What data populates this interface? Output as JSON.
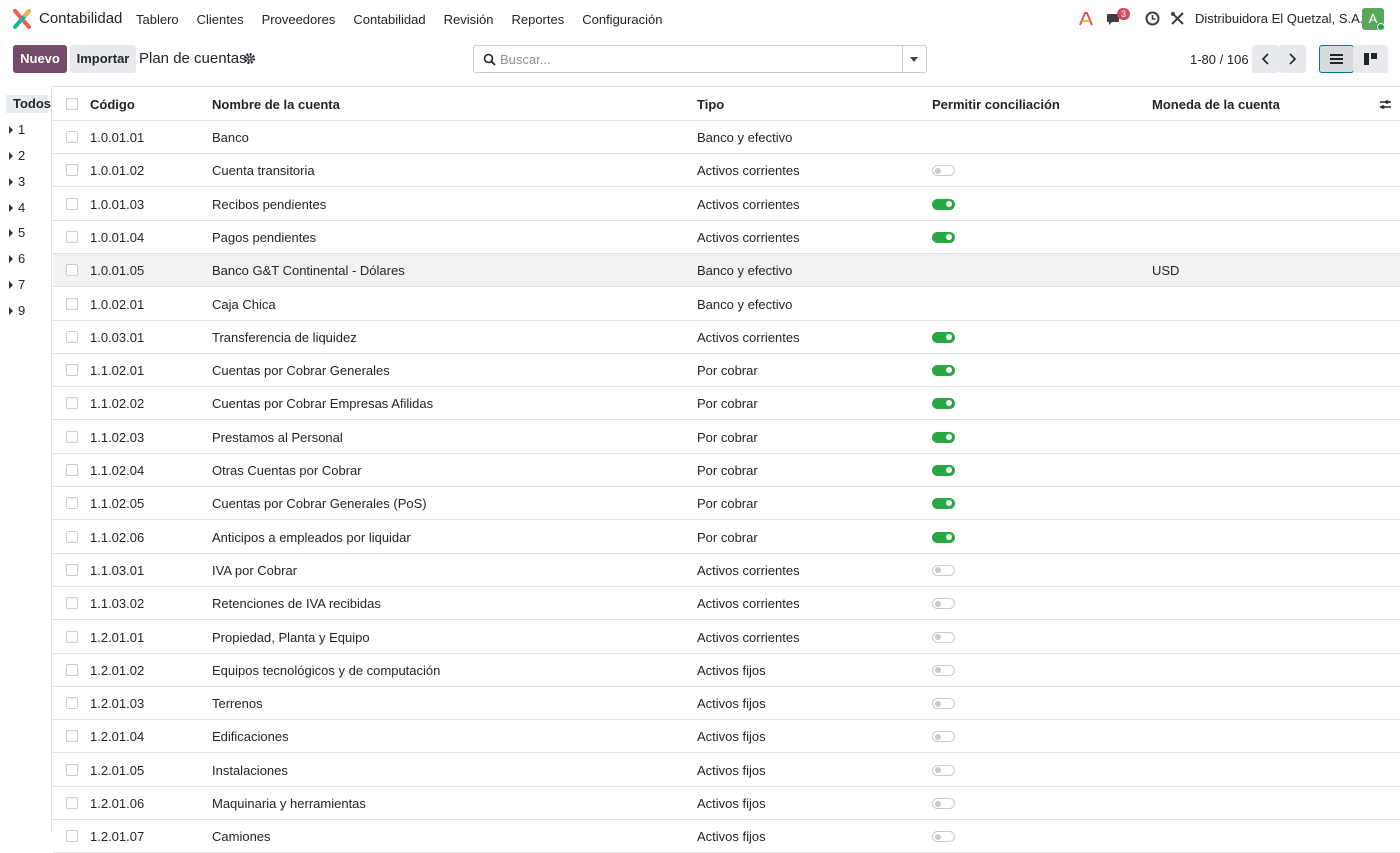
{
  "app": {
    "name": "Contabilidad",
    "menu": [
      "Tablero",
      "Clientes",
      "Proveedores",
      "Contabilidad",
      "Revisión",
      "Reportes",
      "Configuración"
    ],
    "notification_count": "3",
    "company": "Distribuidora El Quetzal, S.A.",
    "avatar_letter": "A",
    "brand_color": "#714b67",
    "toggle_on_color": "#28a745"
  },
  "control": {
    "new_label": "Nuevo",
    "import_label": "Importar",
    "title": "Plan de cuentas",
    "search_placeholder": "Buscar...",
    "pager": "1-80 / 106"
  },
  "sidebar": {
    "all_label": "Todos",
    "groups": [
      "1",
      "2",
      "3",
      "4",
      "5",
      "6",
      "7",
      "9"
    ]
  },
  "table": {
    "columns": {
      "code": "Código",
      "name": "Nombre de la cuenta",
      "type": "Tipo",
      "reconcile": "Permitir conciliación",
      "currency": "Moneda de la cuenta"
    },
    "rows": [
      {
        "code": "1.0.01.01",
        "name": "Banco",
        "type": "Banco y efectivo",
        "reconcile": null,
        "currency": ""
      },
      {
        "code": "1.0.01.02",
        "name": "Cuenta transitoria",
        "type": "Activos corrientes",
        "reconcile": false,
        "currency": ""
      },
      {
        "code": "1.0.01.03",
        "name": "Recibos pendientes",
        "type": "Activos corrientes",
        "reconcile": true,
        "currency": ""
      },
      {
        "code": "1.0.01.04",
        "name": "Pagos pendientes",
        "type": "Activos corrientes",
        "reconcile": true,
        "currency": ""
      },
      {
        "code": "1.0.01.05",
        "name": "Banco G&T Continental - Dólares",
        "type": "Banco y efectivo",
        "reconcile": null,
        "currency": "USD",
        "highlight": true
      },
      {
        "code": "1.0.02.01",
        "name": "Caja Chica",
        "type": "Banco y efectivo",
        "reconcile": null,
        "currency": ""
      },
      {
        "code": "1.0.03.01",
        "name": "Transferencia de liquidez",
        "type": "Activos corrientes",
        "reconcile": true,
        "currency": ""
      },
      {
        "code": "1.1.02.01",
        "name": "Cuentas por Cobrar Generales",
        "type": "Por cobrar",
        "reconcile": true,
        "currency": ""
      },
      {
        "code": "1.1.02.02",
        "name": "Cuentas por Cobrar Empresas Afilidas",
        "type": "Por cobrar",
        "reconcile": true,
        "currency": ""
      },
      {
        "code": "1.1.02.03",
        "name": "Prestamos al Personal",
        "type": "Por cobrar",
        "reconcile": true,
        "currency": ""
      },
      {
        "code": "1.1.02.04",
        "name": "Otras Cuentas por Cobrar",
        "type": "Por cobrar",
        "reconcile": true,
        "currency": ""
      },
      {
        "code": "1.1.02.05",
        "name": "Cuentas por Cobrar Generales (PoS)",
        "type": "Por cobrar",
        "reconcile": true,
        "currency": ""
      },
      {
        "code": "1.1.02.06",
        "name": "Anticipos a empleados por liquidar",
        "type": "Por cobrar",
        "reconcile": true,
        "currency": ""
      },
      {
        "code": "1.1.03.01",
        "name": "IVA por Cobrar",
        "type": "Activos corrientes",
        "reconcile": false,
        "currency": ""
      },
      {
        "code": "1.1.03.02",
        "name": "Retenciones de IVA recibidas",
        "type": "Activos corrientes",
        "reconcile": false,
        "currency": ""
      },
      {
        "code": "1.2.01.01",
        "name": "Propiedad, Planta y Equipo",
        "type": "Activos corrientes",
        "reconcile": false,
        "currency": ""
      },
      {
        "code": "1.2.01.02",
        "name": "Equipos tecnológicos y de computación",
        "type": "Activos fijos",
        "reconcile": false,
        "currency": ""
      },
      {
        "code": "1.2.01.03",
        "name": "Terrenos",
        "type": "Activos fijos",
        "reconcile": false,
        "currency": ""
      },
      {
        "code": "1.2.01.04",
        "name": "Edificaciones",
        "type": "Activos fijos",
        "reconcile": false,
        "currency": ""
      },
      {
        "code": "1.2.01.05",
        "name": "Instalaciones",
        "type": "Activos fijos",
        "reconcile": false,
        "currency": ""
      },
      {
        "code": "1.2.01.06",
        "name": "Maquinaria y herramientas",
        "type": "Activos fijos",
        "reconcile": false,
        "currency": ""
      },
      {
        "code": "1.2.01.07",
        "name": "Camiones",
        "type": "Activos fijos",
        "reconcile": false,
        "currency": ""
      }
    ]
  }
}
